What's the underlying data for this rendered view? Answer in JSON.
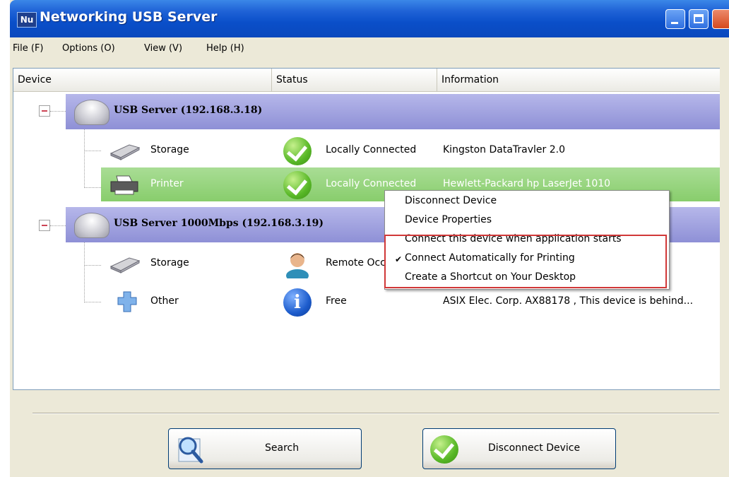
{
  "window": {
    "title": "Networking USB Server",
    "app_icon": "Nu"
  },
  "menubar": {
    "items": [
      {
        "label": "File (F)"
      },
      {
        "label": "Options (O)"
      },
      {
        "label": "View (V)"
      },
      {
        "label": "Help (H)"
      }
    ]
  },
  "table": {
    "columns": [
      "Device",
      "Status",
      "Information"
    ],
    "groups": [
      {
        "label": "USB Server  (192.168.3.18)",
        "devices": [
          {
            "name": "Storage",
            "status": "Locally Connected",
            "status_icon": "check-icon",
            "info": "Kingston DataTravler 2.0"
          },
          {
            "name": "Printer",
            "status": "Locally Connected",
            "status_icon": "check-icon",
            "info": "Hewlett-Packard hp LaserJet 1010",
            "selected": true
          }
        ]
      },
      {
        "label": "USB Server 1000Mbps  (192.168.3.19)",
        "devices": [
          {
            "name": "Storage",
            "status": "Remote Occupied",
            "status_icon": "user-icon",
            "info": ""
          },
          {
            "name": "Other",
            "status": "Free",
            "status_icon": "info-icon",
            "info": "ASIX Elec. Corp. AX88178 , This device is behind..."
          }
        ]
      }
    ]
  },
  "context_menu": {
    "items": [
      {
        "label": "Disconnect Device",
        "checked": false
      },
      {
        "label": "Device Properties",
        "checked": false
      },
      {
        "label": "Connect this device when application starts",
        "checked": false
      },
      {
        "label": "Connect Automatically for Printing",
        "checked": true
      },
      {
        "label": "Create a Shortcut on Your Desktop",
        "checked": false
      }
    ],
    "check_glyph": "✔"
  },
  "buttons": {
    "search": "Search",
    "disconnect": "Disconnect Device"
  },
  "colors": {
    "titlebar": "#0a4fc9",
    "group_row": "#9a9cdc",
    "selected_row": "#88cd6c",
    "highlight_box": "#d13838"
  }
}
